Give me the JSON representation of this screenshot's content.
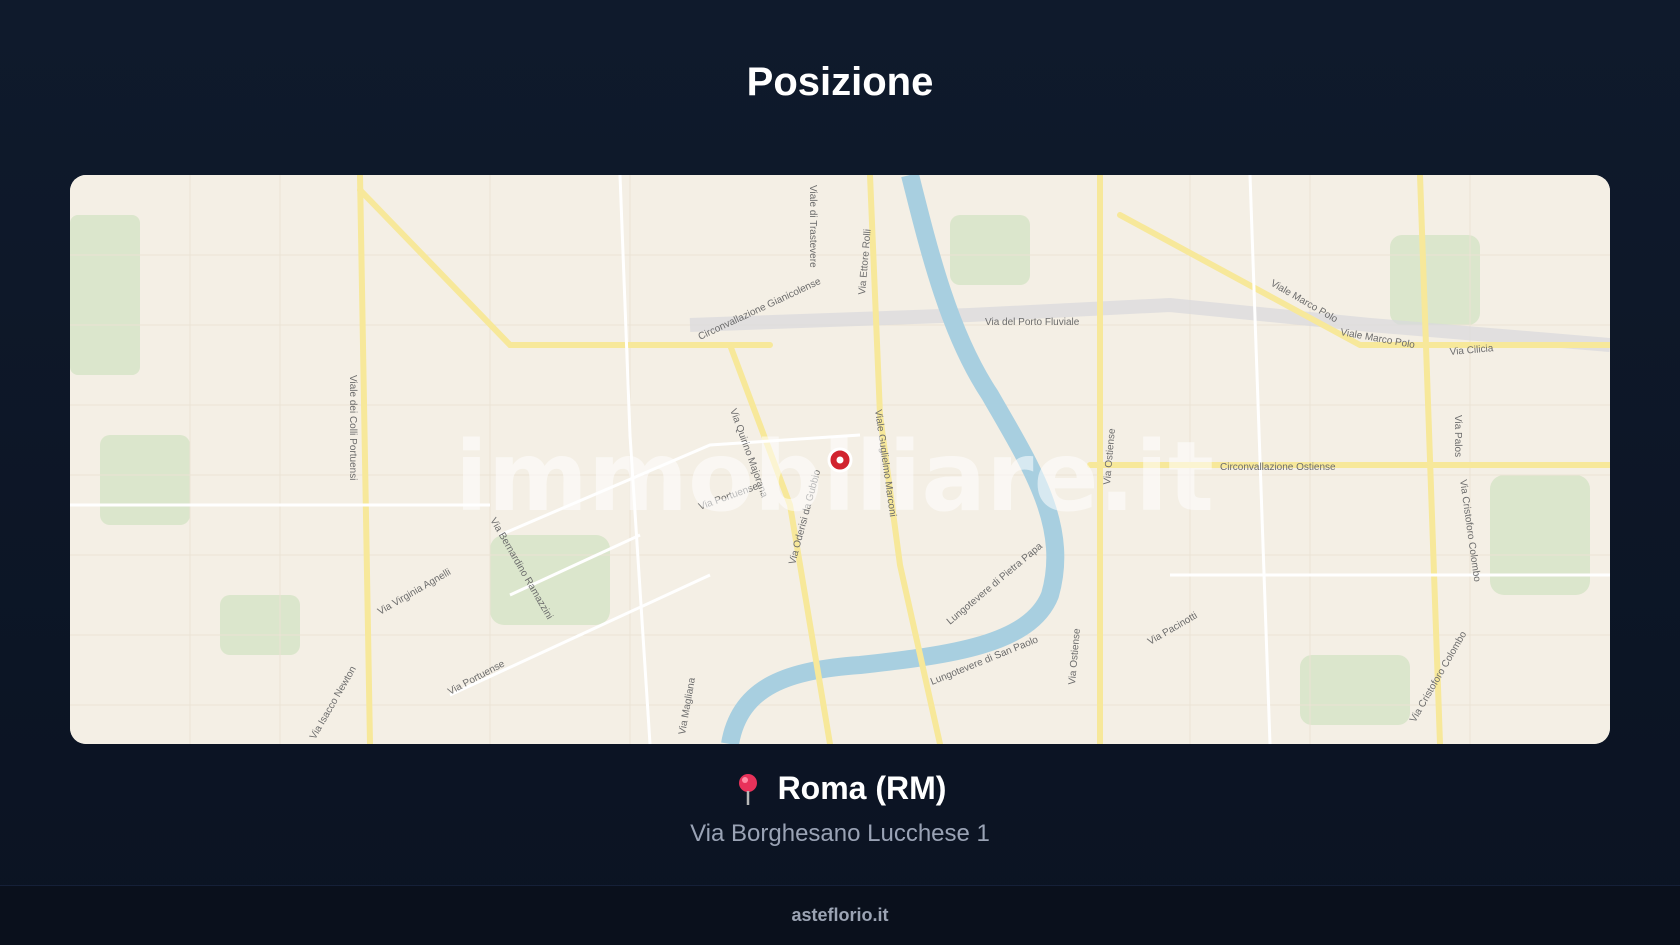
{
  "page": {
    "title": "Posizione"
  },
  "map": {
    "watermark": "immobiliare.it",
    "street_labels": [
      "Viale dei Colli Portuensi",
      "Circonvallazione Gianicolense",
      "Viale di Trastevere",
      "Via Ettore Rolli",
      "Via del Porto Fluviale",
      "Via Ostiense",
      "Viale Marco Polo",
      "Via Cilicia",
      "Via Quirino Majorana",
      "Via Portuense",
      "Viale Guglielmo Marconi",
      "Circonvallazione Ostiense",
      "Via Cristoforo Colombo",
      "Lungotevere di San Paolo",
      "Via Cristoforo Colombo",
      "Via Oderisi da Gubbio",
      "Via Bernardino Ramazzini",
      "Via Virginia Agnelli",
      "Via Portuense",
      "Via Magliana",
      "Lungotevere di Pietra Papa",
      "Viale Marco Polo",
      "Via Ostiense",
      "Via Pacinotti",
      "Via Palos",
      "Via Isacco Newton"
    ],
    "marker_icon": "location-pin-icon"
  },
  "location": {
    "pin_icon": "round-pushpin-icon",
    "city": "Roma (RM)",
    "address": "Via Borghesano Lucchese 1"
  },
  "footer": {
    "site": "asteflorio.it"
  },
  "colors": {
    "background": "#0f1a2c",
    "marker": "#d1232f",
    "river": "#a8cfe0",
    "main_road": "#f7e89a"
  }
}
